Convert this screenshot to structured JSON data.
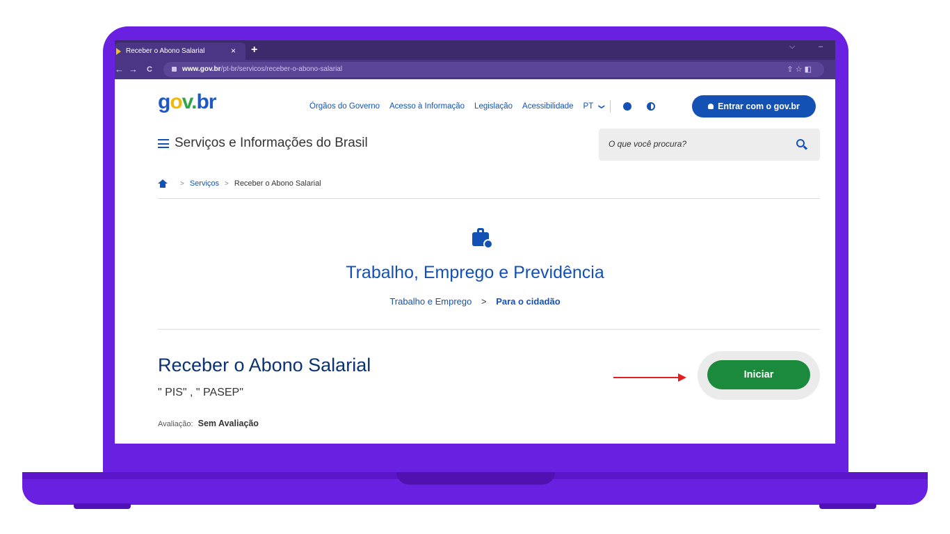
{
  "browser": {
    "tab_title": "Receber o Abono Salarial",
    "tab_close": "×",
    "new_tab": "+",
    "url_host": "www.gov.br",
    "url_path": "/pt-br/servicos/receber-o-abono-salarial",
    "nav": {
      "back": "←",
      "forward": "→",
      "reload": "C"
    },
    "window_controls": {
      "dropdown": "⌵",
      "minimize": "–"
    },
    "url_actions": "⇪  ☆  ◧"
  },
  "logo": {
    "g": "g",
    "o": "o",
    "v": "v",
    "dot": ".",
    "br": "br"
  },
  "topnav": {
    "items": [
      "Órgãos do Governo",
      "Acesso à Informação",
      "Legislação",
      "Acessibilidade"
    ],
    "language": "PT",
    "lang_chevron": "❯"
  },
  "login_button": "Entrar com o gov.br",
  "site_title": "Serviços e Informações do Brasil",
  "search": {
    "placeholder": "O que você procura?"
  },
  "breadcrumb": {
    "items": [
      "Serviços",
      "Receber o Abono Salarial"
    ],
    "separator": ">"
  },
  "category": {
    "title": "Trabalho, Emprego e Previdência",
    "subnav_parent": "Trabalho e Emprego",
    "subnav_separator": ">",
    "subnav_current": "Para o cidadão"
  },
  "service": {
    "title": "Receber o Abono Salarial",
    "tags": "\" PIS\" , \" PASEP\"",
    "rating_label": "Avaliação:",
    "rating_value": "Sem Avaliação"
  },
  "start_button": "Iniciar",
  "colors": {
    "brand_blue": "#1351b4",
    "start_green": "#1c8a3c",
    "laptop_frame": "#6a20e0",
    "annotation_arrow": "#e02020"
  }
}
